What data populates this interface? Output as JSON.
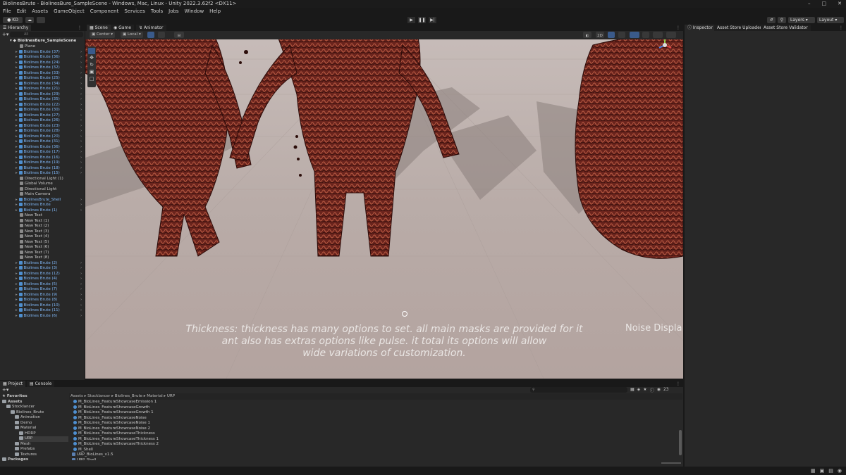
{
  "window": {
    "title": "BiolinesBrute - BiolinesBure_SampleScene - Windows, Mac, Linux - Unity 2022.3.62f2 <DX11>"
  },
  "menu": [
    "File",
    "Edit",
    "Assets",
    "GameObject",
    "Component",
    "Services",
    "Tools",
    "Jobs",
    "Window",
    "Help"
  ],
  "toolbar": {
    "account": "KD",
    "layers": "Layers",
    "layout": "Layout"
  },
  "hierarchy": {
    "tab": "Hierarchy",
    "search_placeholder": "All",
    "scene": "BiolinesBure_SampleScene",
    "items": [
      {
        "label": "Plane",
        "kind": "grey"
      },
      {
        "label": "Biolines Brute (37)",
        "kind": "blue"
      },
      {
        "label": "Biolines Brute (36)",
        "kind": "blue"
      },
      {
        "label": "Biolines Brute (24)",
        "kind": "blue"
      },
      {
        "label": "Biolines Brute (32)",
        "kind": "blue"
      },
      {
        "label": "Biolines Brute (33)",
        "kind": "blue"
      },
      {
        "label": "Biolines Brute (25)",
        "kind": "blue"
      },
      {
        "label": "Biolines Brute (34)",
        "kind": "blue"
      },
      {
        "label": "Biolines Brute (21)",
        "kind": "blue"
      },
      {
        "label": "Biolines Brute (29)",
        "kind": "blue"
      },
      {
        "label": "Biolines Brute (35)",
        "kind": "blue"
      },
      {
        "label": "Biolines Brute (22)",
        "kind": "blue"
      },
      {
        "label": "Biolines Brute (30)",
        "kind": "blue"
      },
      {
        "label": "Biolines Brute (27)",
        "kind": "blue"
      },
      {
        "label": "Biolines Brute (26)",
        "kind": "blue"
      },
      {
        "label": "Biolines Brute (23)",
        "kind": "blue"
      },
      {
        "label": "Biolines Brute (28)",
        "kind": "blue"
      },
      {
        "label": "Biolines Brute (20)",
        "kind": "blue"
      },
      {
        "label": "Biolines Brute (31)",
        "kind": "blue"
      },
      {
        "label": "Biolines Brute (36)",
        "kind": "blue"
      },
      {
        "label": "Biolines Brute (17)",
        "kind": "blue"
      },
      {
        "label": "Biolines Brute (16)",
        "kind": "blue"
      },
      {
        "label": "Biolines Brute (19)",
        "kind": "blue"
      },
      {
        "label": "Biolines Brute (18)",
        "kind": "blue"
      },
      {
        "label": "Biolines Brute (15)",
        "kind": "blue"
      },
      {
        "label": "Directional Light (1)",
        "kind": "grey"
      },
      {
        "label": "Global Volume",
        "kind": "grey"
      },
      {
        "label": "Directional Light",
        "kind": "grey"
      },
      {
        "label": "Main Camera",
        "kind": "grey"
      },
      {
        "label": "BiolinesBrute_Shell",
        "kind": "blue"
      },
      {
        "label": "Biolines Brute",
        "kind": "blue"
      },
      {
        "label": "Biolines Brute (1)",
        "kind": "blue"
      },
      {
        "label": "New Text",
        "kind": "grey"
      },
      {
        "label": "New Text (1)",
        "kind": "grey"
      },
      {
        "label": "New Text (2)",
        "kind": "grey"
      },
      {
        "label": "New Text (3)",
        "kind": "grey"
      },
      {
        "label": "New Text (4)",
        "kind": "grey"
      },
      {
        "label": "New Text (5)",
        "kind": "grey"
      },
      {
        "label": "New Text (6)",
        "kind": "grey"
      },
      {
        "label": "New Text (7)",
        "kind": "grey"
      },
      {
        "label": "New Text (8)",
        "kind": "grey"
      },
      {
        "label": "Biolines Brute (2)",
        "kind": "blue"
      },
      {
        "label": "Biolines Brute (3)",
        "kind": "blue"
      },
      {
        "label": "Biolines Brute (12)",
        "kind": "blue"
      },
      {
        "label": "Biolines Brute (4)",
        "kind": "blue"
      },
      {
        "label": "Biolines Brute (5)",
        "kind": "blue"
      },
      {
        "label": "Biolines Brute (7)",
        "kind": "blue"
      },
      {
        "label": "Biolines Brute (9)",
        "kind": "blue"
      },
      {
        "label": "Biolines Brute (8)",
        "kind": "blue"
      },
      {
        "label": "Biolines Brute (10)",
        "kind": "blue"
      },
      {
        "label": "Biolines Brute (11)",
        "kind": "blue"
      },
      {
        "label": "Biolines Brute (6)",
        "kind": "blue"
      }
    ]
  },
  "scene_view": {
    "tabs": [
      "Scene",
      "Game",
      "Animator"
    ],
    "pivot": "Center",
    "space": "Local",
    "mode_2d": "2D",
    "overlay_line1": "Thickness:  thickness has many options to set. all main masks are provided for it",
    "overlay_line2": "ant also has extras options like pulse. it total its options will allow",
    "overlay_line3": "wide  variations of customization.",
    "overlay_right": "Noise Displa"
  },
  "inspector": {
    "tabs": [
      "Inspector",
      "Asset Store Uploader",
      "Asset Store Validator"
    ]
  },
  "project": {
    "tabs": [
      "Project",
      "Console"
    ],
    "breadcrumb": [
      "Assets",
      "Stocklancer",
      "Biolines_Brute",
      "Material",
      "URP"
    ],
    "count": "23",
    "tree": [
      {
        "label": "Favorites",
        "depth": 0
      },
      {
        "label": "Assets",
        "depth": 0
      },
      {
        "label": "Stocklancer",
        "depth": 1
      },
      {
        "label": "Biolines_Brute",
        "depth": 2
      },
      {
        "label": "Animation",
        "depth": 3
      },
      {
        "label": "Demo",
        "depth": 3
      },
      {
        "label": "Material",
        "depth": 3
      },
      {
        "label": "HDRP",
        "depth": 4
      },
      {
        "label": "URP",
        "depth": 4
      },
      {
        "label": "Mesh",
        "depth": 3
      },
      {
        "label": "Prefabs",
        "depth": 3
      },
      {
        "label": "Textures",
        "depth": 3
      },
      {
        "label": "Packages",
        "depth": 0
      }
    ],
    "files": [
      "M_BioLines_FeatureShowcaseEmission 1",
      "M_BioLines_FeatureShowcaseGrowth",
      "M_BioLines_FeatureShowcaseGrowth 1",
      "M_BioLines_FeatureShowcaseNoise",
      "M_BioLines_FeatureShowcaseNoise 1",
      "M_BioLines_FeatureShowcaseNoise 2",
      "M_BioLines_FeatureShowcaseThickness",
      "M_BioLines_FeatureShowcaseThickness 1",
      "M_BioLines_FeatureShowcaseThickness 2",
      "M_Shell",
      "URP_BioLines_v1.5",
      "URP_Shell"
    ]
  },
  "colors": {
    "accent": "#7fb6f5",
    "panel": "#282828",
    "scene_floor": "#b8aba7",
    "creature": "#7a2e25"
  }
}
